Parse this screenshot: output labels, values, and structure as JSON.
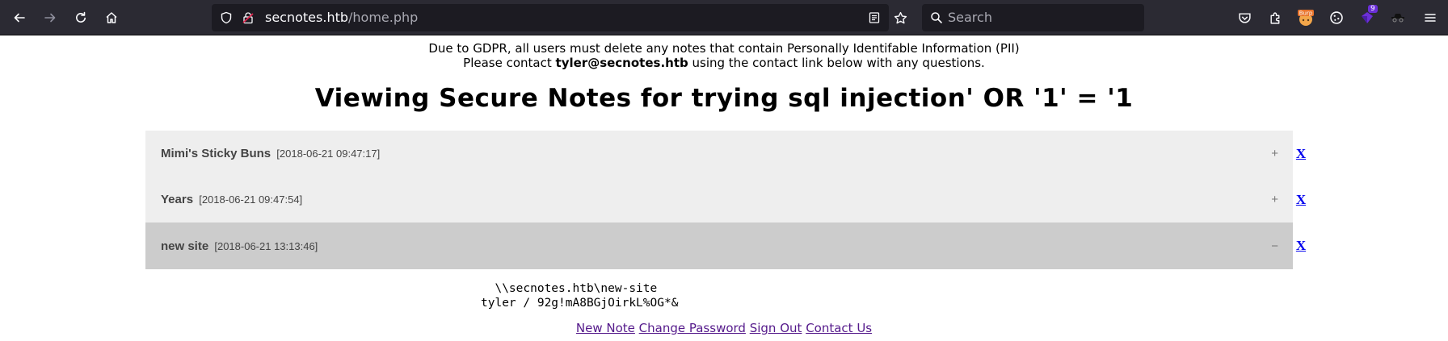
{
  "browser": {
    "url_host": "secnotes.htb",
    "url_path": "/home.php",
    "search_placeholder": "Search",
    "ext_badge_count": "9",
    "burp_label": "Burp"
  },
  "notice": {
    "line1": "Due to GDPR, all users must delete any notes that contain Personally Identifable Information (PII)",
    "line2_pre": "Please contact ",
    "line2_email": "tyler@secnotes.htb",
    "line2_post": " using the contact link below with any questions."
  },
  "page_title": "Viewing Secure Notes for trying sql injection' OR '1' = '1",
  "notes": [
    {
      "title": "Mimi's Sticky Buns",
      "timestamp": "[2018-06-21 09:47:17]",
      "toggle": "+",
      "delete": "X"
    },
    {
      "title": "Years",
      "timestamp": "[2018-06-21 09:47:54]",
      "toggle": "+",
      "delete": "X"
    },
    {
      "title": "new site",
      "timestamp": "[2018-06-21 13:13:46]",
      "toggle": "−",
      "delete": "X"
    }
  ],
  "open_note_content": {
    "line1": "  \\\\secnotes.htb\\new-site",
    "line2": "tyler / 92g!mA8BGjOirkL%OG*&"
  },
  "footer_links": {
    "new_note": "New Note",
    "change_password": "Change Password",
    "sign_out": "Sign Out",
    "contact_us": "Contact Us"
  }
}
